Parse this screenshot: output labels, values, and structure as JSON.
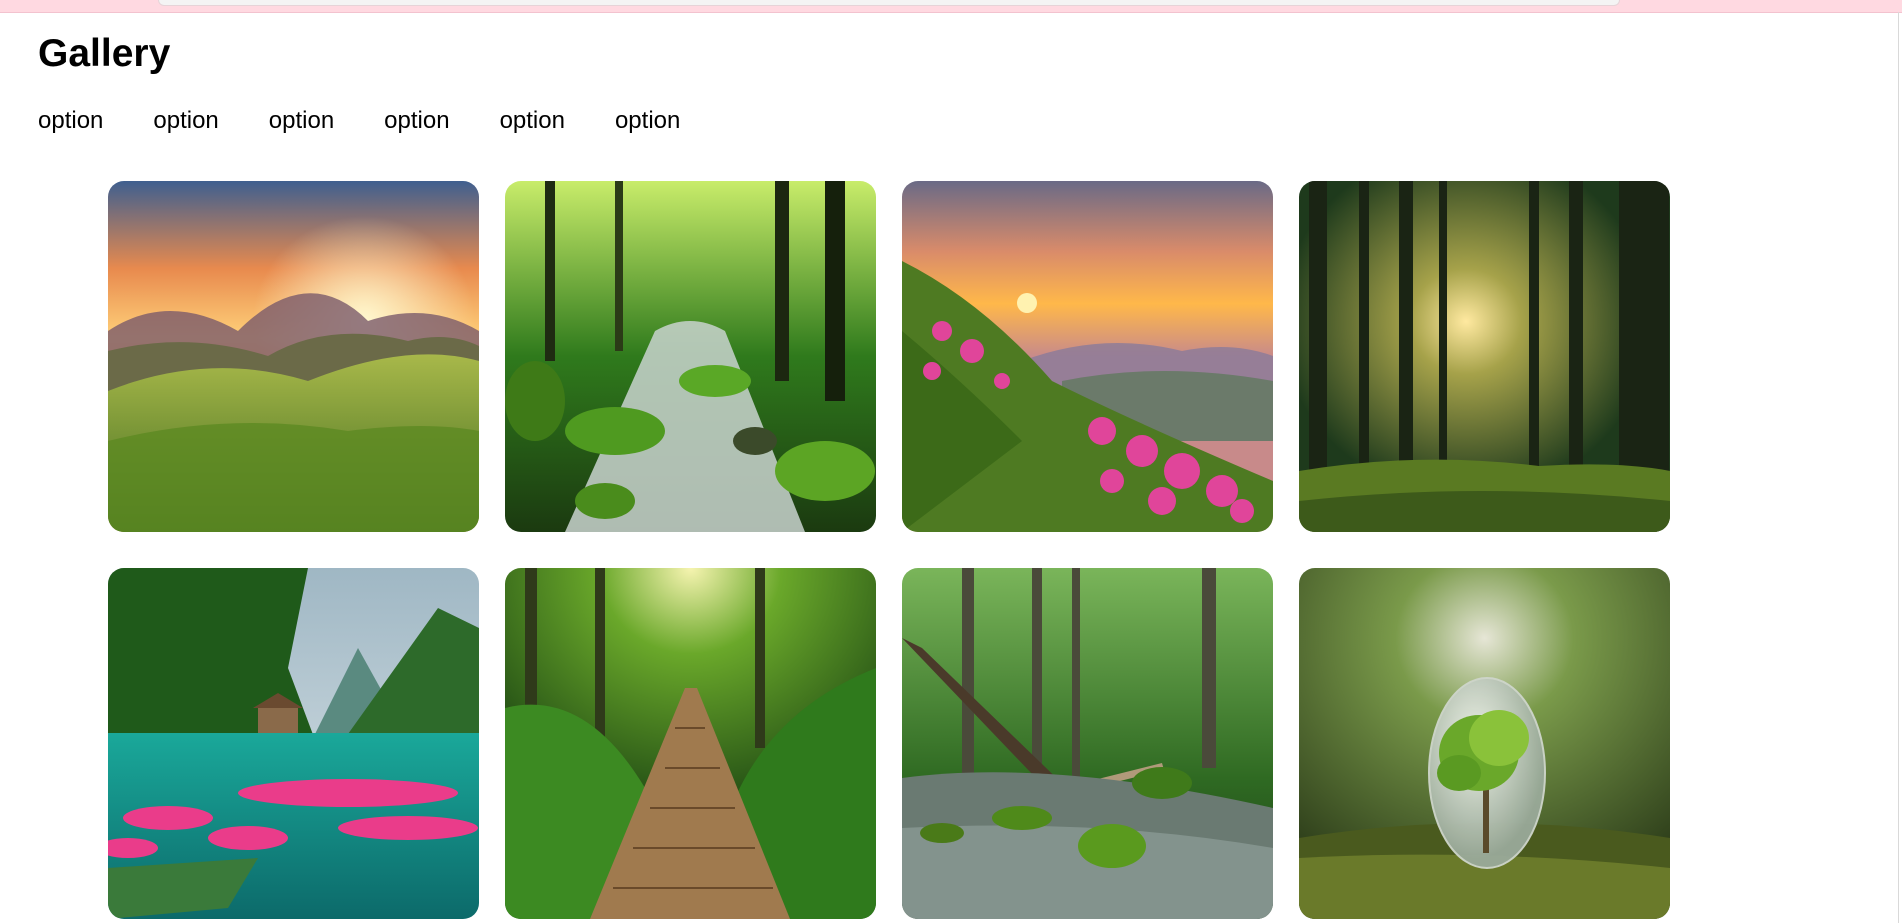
{
  "page": {
    "title": "Gallery",
    "options": [
      "option",
      "option",
      "option",
      "option",
      "option",
      "option"
    ]
  },
  "gallery": {
    "images": [
      {
        "subject": "mountain-sunset-meadow"
      },
      {
        "subject": "forest-stream-mossy-rocks"
      },
      {
        "subject": "mountain-sunset-pink-flowers"
      },
      {
        "subject": "sunlit-pine-forest"
      },
      {
        "subject": "lake-cabin-water-lilies"
      },
      {
        "subject": "jungle-boardwalk-path"
      },
      {
        "subject": "forest-river-fallen-log"
      },
      {
        "subject": "glass-globe-tree-on-moss"
      }
    ]
  },
  "colors": {
    "top_strip": "#ffd9e1",
    "text": "#000000",
    "background": "#ffffff"
  }
}
